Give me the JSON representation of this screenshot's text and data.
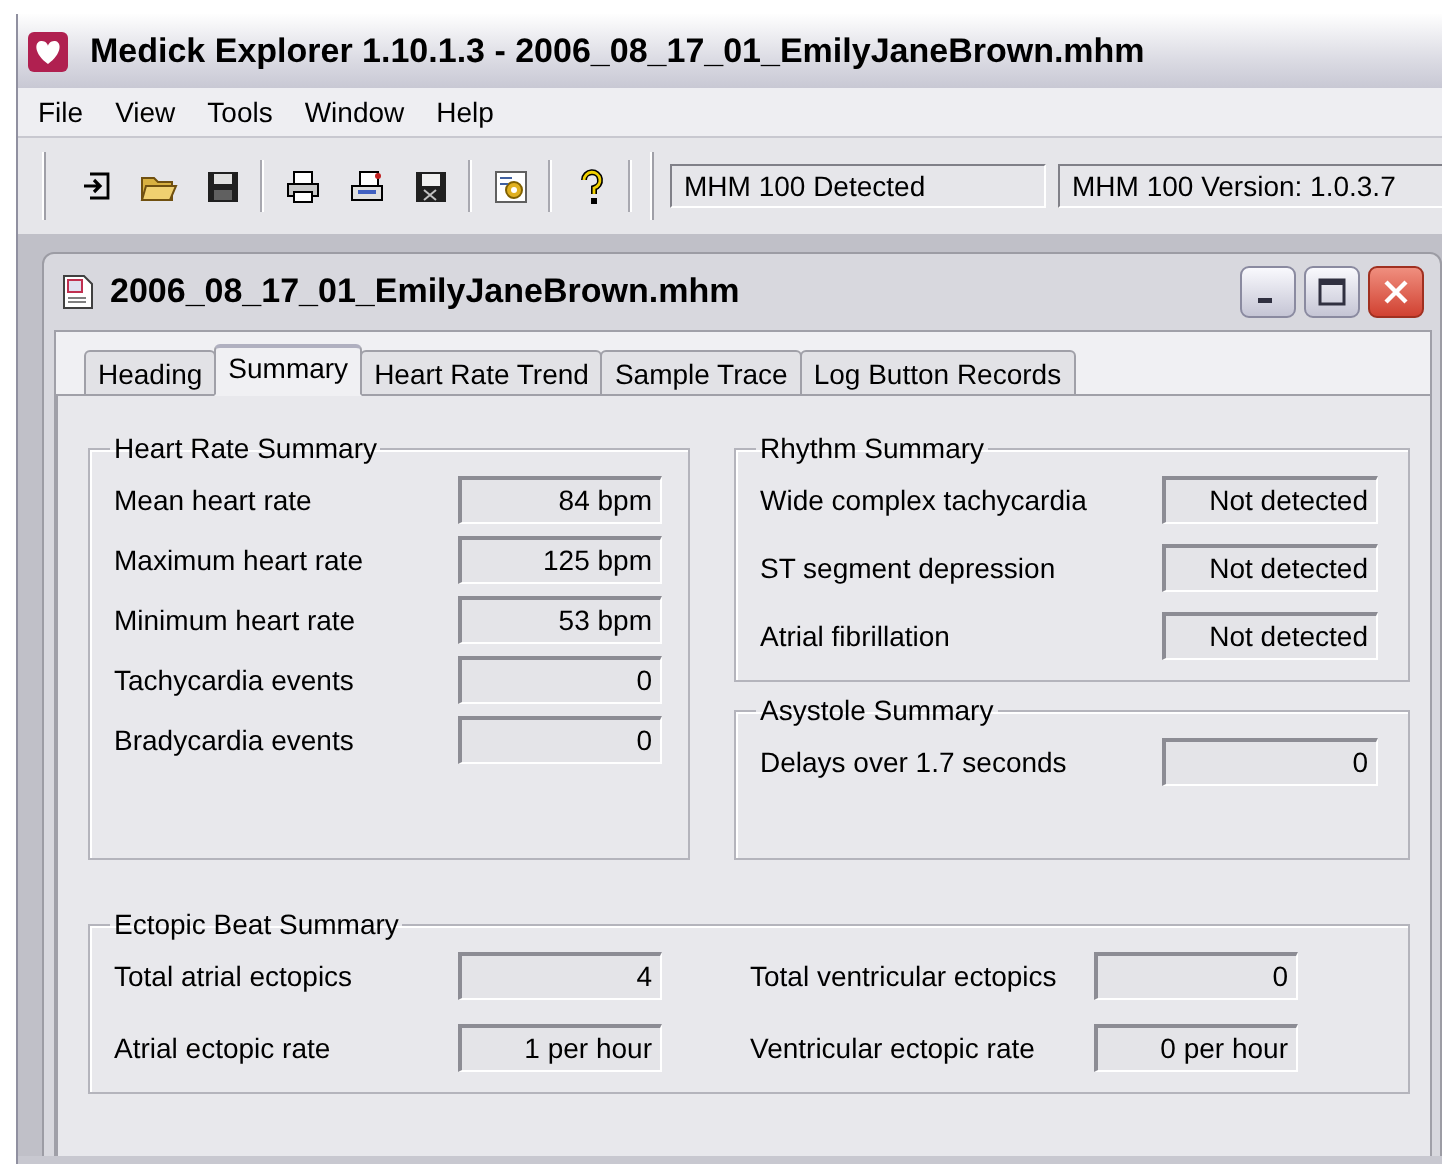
{
  "window": {
    "title": "Medick Explorer 1.10.1.3 - 2006_08_17_01_EmilyJaneBrown.mhm"
  },
  "menu": [
    "File",
    "View",
    "Tools",
    "Window",
    "Help"
  ],
  "toolbar": {
    "status_fields": [
      "MHM 100 Detected",
      "MHM 100 Version: 1.0.3.7"
    ]
  },
  "document": {
    "title": "2006_08_17_01_EmilyJaneBrown.mhm",
    "tabs": [
      {
        "label": "Heading",
        "selected": false
      },
      {
        "label": "Summary",
        "selected": true
      },
      {
        "label": "Heart Rate Trend",
        "selected": false
      },
      {
        "label": "Sample Trace",
        "selected": false
      },
      {
        "label": "Log Button Records",
        "selected": false
      }
    ],
    "groups": [
      {
        "title": "Heart Rate Summary",
        "rows": [
          {
            "label": "Mean heart rate",
            "value": "84 bpm"
          },
          {
            "label": "Maximum heart rate",
            "value": "125 bpm"
          },
          {
            "label": "Minimum heart rate",
            "value": "53 bpm"
          },
          {
            "label": "Tachycardia events",
            "value": "0"
          },
          {
            "label": "Bradycardia events",
            "value": "0"
          }
        ]
      },
      {
        "title": "Rhythm Summary",
        "rows": [
          {
            "label": "Wide complex tachycardia",
            "value": "Not detected"
          },
          {
            "label": "ST segment depression",
            "value": "Not detected"
          },
          {
            "label": "Atrial fibrillation",
            "value": "Not detected"
          }
        ]
      },
      {
        "title": "Asystole Summary",
        "rows": [
          {
            "label": "Delays over 1.7 seconds",
            "value": "0"
          }
        ]
      },
      {
        "title": "Ectopic Beat Summary",
        "rows": [
          {
            "label": "Total atrial ectopics",
            "value": "4"
          },
          {
            "label": "Total ventricular ectopics",
            "value": "0"
          },
          {
            "label": "Atrial ectopic rate",
            "value": "1 per hour"
          },
          {
            "label": "Ventricular ectopic rate",
            "value": "0 per hour"
          }
        ]
      }
    ]
  }
}
